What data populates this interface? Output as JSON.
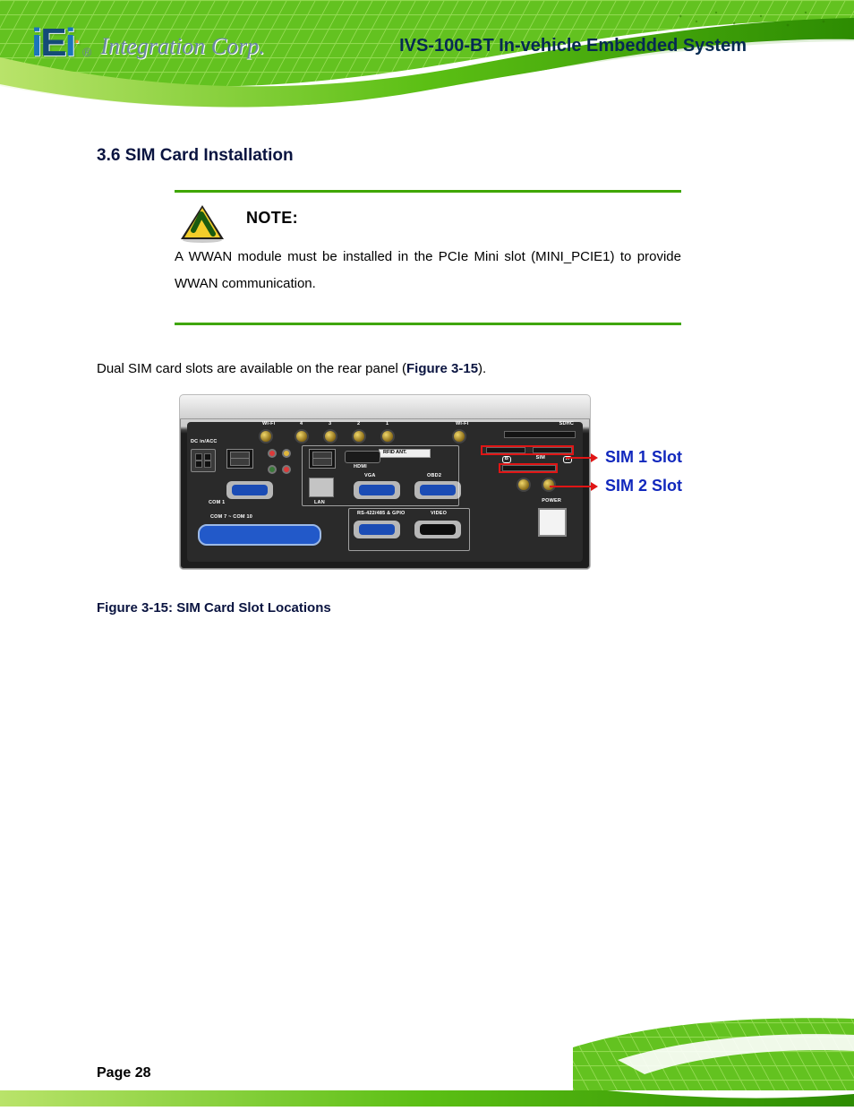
{
  "brand": {
    "logo_text": "iEi",
    "logo_subtitle": "Integration Corp.",
    "reg": "®"
  },
  "header": {
    "app_name": "IVS-100-BT In-vehicle Embedded System"
  },
  "section": {
    "number": "3.6",
    "title": "SIM Card Installation"
  },
  "note": {
    "head": "NOTE:",
    "body": "A WWAN module must be installed in the PCIe Mini slot (MINI_PCIE1) to provide WWAN communication."
  },
  "intro": {
    "text": "Dual SIM card slots are available on the rear panel (",
    "ref": "Figure 3-15",
    "text2": ")."
  },
  "figure": {
    "number": "Figure 3-15",
    "caption_text": "SIM Card Slot Locations",
    "labels": {
      "sim1": "SIM 1 Slot",
      "sim2": "SIM 2 Slot"
    },
    "panel_text": {
      "wifi_l": "Wi-Fi",
      "wifi_r": "Wi-Fi",
      "ant1": "1",
      "ant2": "2",
      "ant3": "3",
      "ant4": "4",
      "sdhc": "SDHC",
      "sim": "SIM",
      "a": "A",
      "b": "B",
      "dc": "DC in/ACC",
      "com1": "COM 1",
      "hdmi": "HDMI",
      "lan": "LAN",
      "vga": "VGA",
      "obd2": "OBD2",
      "rfid": "RFID ANT.",
      "power": "POWER",
      "com7_10": "COM 7 ~ COM 10",
      "rs": "RS-422/485 & GPIO",
      "video": "VIDEO"
    }
  },
  "page_number": "Page 28"
}
